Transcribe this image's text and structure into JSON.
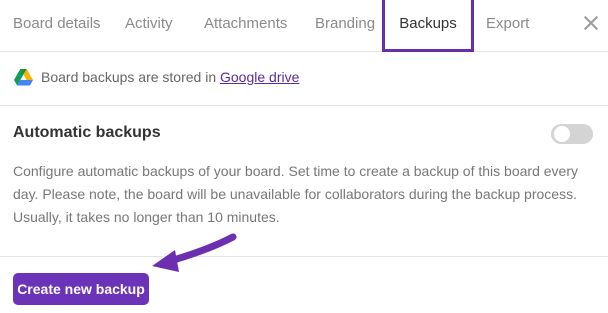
{
  "tabs": [
    {
      "label": "Board details",
      "active": false
    },
    {
      "label": "Activity",
      "active": false
    },
    {
      "label": "Attachments",
      "active": false
    },
    {
      "label": "Branding",
      "active": false
    },
    {
      "label": "Backups",
      "active": true
    },
    {
      "label": "Export",
      "active": false
    }
  ],
  "info": {
    "icon": "google-drive-icon",
    "text": "Board backups are stored in ",
    "link_label": "Google drive"
  },
  "automatic_backups": {
    "title": "Automatic backups",
    "toggle_on": false,
    "description": "Configure automatic backups of your board. Set time to create a backup of this board every day. Please note, the board will be unavailable for collaborators during the backup process. Usually, it takes no longer than 10 minutes."
  },
  "create_button_label": "Create new backup",
  "colors": {
    "accent": "#6b34b8",
    "active_tab_border": "#6a2fa8",
    "annotation_arrow": "#6b2fb0"
  }
}
